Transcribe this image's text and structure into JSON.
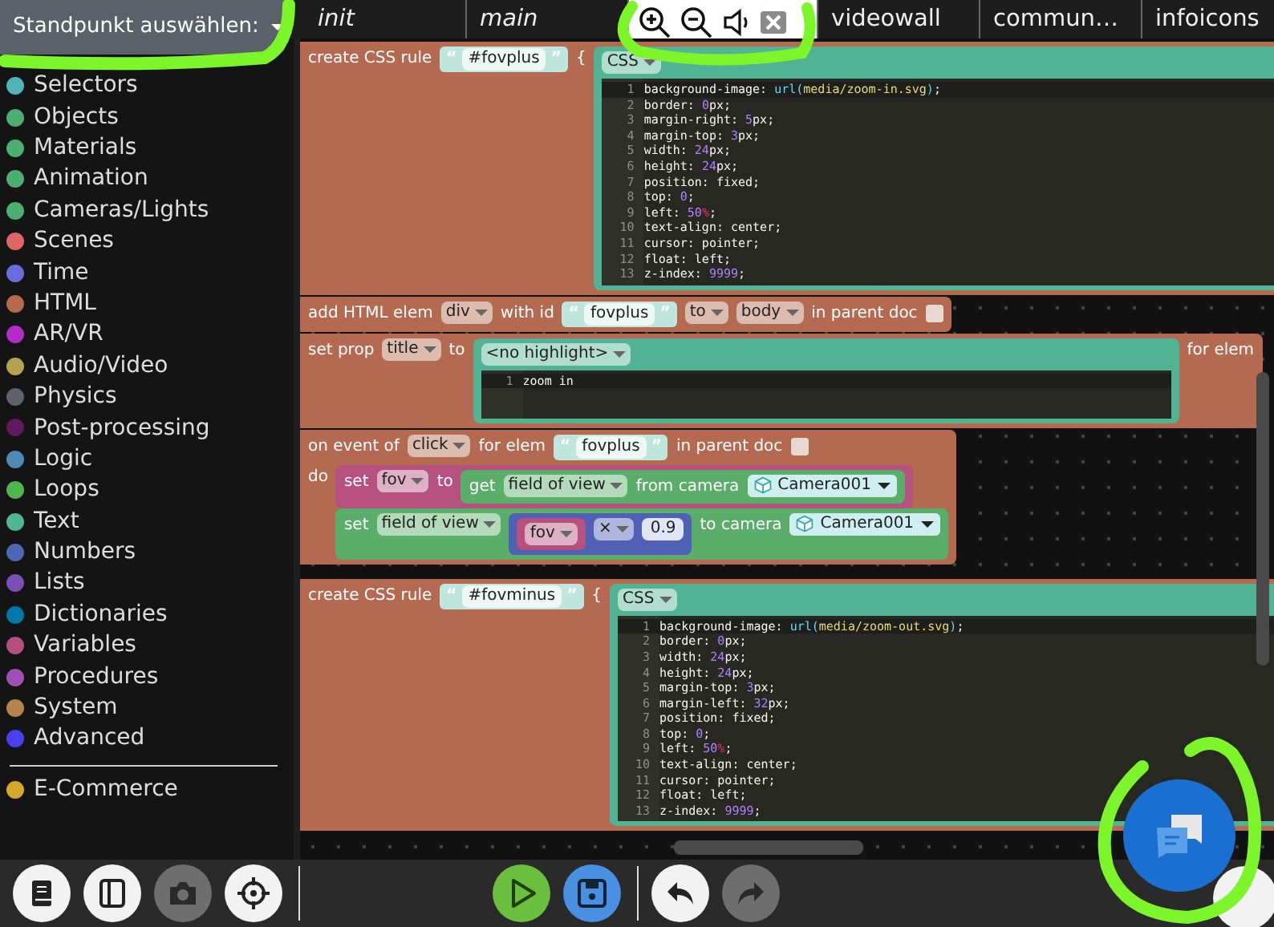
{
  "view_selector": {
    "label": "Standpunkt auswählen:"
  },
  "tabs": [
    {
      "label": "init",
      "italic": true,
      "selected": false
    },
    {
      "label": "main",
      "italic": true,
      "selected": false
    },
    {
      "selected": true,
      "italic": false
    },
    {
      "label": "videowall",
      "italic": false,
      "selected": false
    },
    {
      "label": "commun…",
      "italic": false,
      "selected": false
    },
    {
      "label": "infoicons",
      "italic": false,
      "selected": false
    }
  ],
  "sidebar": {
    "categories": [
      {
        "name": "Selectors",
        "color": "#4fb3b8"
      },
      {
        "name": "Objects",
        "color": "#4caf72"
      },
      {
        "name": "Materials",
        "color": "#4caf72"
      },
      {
        "name": "Animation",
        "color": "#4caf72"
      },
      {
        "name": "Cameras/Lights",
        "color": "#4caf72"
      },
      {
        "name": "Scenes",
        "color": "#e06666"
      },
      {
        "name": "Time",
        "color": "#6b6be0"
      },
      {
        "name": "HTML",
        "color": "#b5694f"
      },
      {
        "name": "AR/VR",
        "color": "#b52bc8"
      },
      {
        "name": "Audio/Video",
        "color": "#b5a24f"
      },
      {
        "name": "Physics",
        "color": "#5f6168"
      },
      {
        "name": "Post-processing",
        "color": "#5e1a5e"
      },
      {
        "name": "Logic",
        "color": "#4f87b5"
      },
      {
        "name": "Loops",
        "color": "#4fb54f"
      },
      {
        "name": "Text",
        "color": "#4fb594"
      },
      {
        "name": "Numbers",
        "color": "#4f66b5"
      },
      {
        "name": "Lists",
        "color": "#7a4fb5"
      },
      {
        "name": "Dictionaries",
        "color": "#0077aa"
      },
      {
        "name": "Variables",
        "color": "#b54f7f"
      },
      {
        "name": "Procedures",
        "color": "#a04fb5"
      },
      {
        "name": "System",
        "color": "#b5844f"
      },
      {
        "name": "Advanced",
        "color": "#4a3ff0"
      }
    ],
    "extra_categories": [
      {
        "name": "E-Commerce",
        "color": "#d4a82a"
      }
    ]
  },
  "workspace": {
    "blocks": [
      {
        "color": "#b36a50",
        "rows": [
          [
            {
              "kind": "label",
              "text": "create CSS rule"
            },
            {
              "kind": "string",
              "open": "“",
              "value": "#fovplus",
              "close": "”"
            },
            {
              "kind": "label",
              "text": "{"
            },
            {
              "kind": "block",
              "color": "#52b394",
              "rows": [
                [
                  {
                    "kind": "dropdown",
                    "value": "CSS"
                  }
                ],
                [
                  {
                    "kind": "code",
                    "lines": [
                      {
                        "number": "1",
                        "tokens": [
                          {
                            "kind": "plain",
                            "text": "background-image: "
                          },
                          {
                            "kind": "function",
                            "text": "url("
                          },
                          {
                            "kind": "string",
                            "text": "media/zoom-in.svg"
                          },
                          {
                            "kind": "function",
                            "text": ")"
                          },
                          {
                            "kind": "plain",
                            "text": ";"
                          }
                        ]
                      },
                      {
                        "number": "2",
                        "tokens": [
                          {
                            "kind": "plain",
                            "text": "border: "
                          },
                          {
                            "kind": "number",
                            "text": "0"
                          },
                          {
                            "kind": "plain",
                            "text": "px;"
                          }
                        ]
                      },
                      {
                        "number": "3",
                        "tokens": [
                          {
                            "kind": "plain",
                            "text": "margin-right: "
                          },
                          {
                            "kind": "number",
                            "text": "5"
                          },
                          {
                            "kind": "plain",
                            "text": "px;"
                          }
                        ]
                      },
                      {
                        "number": "4",
                        "tokens": [
                          {
                            "kind": "plain",
                            "text": "margin-top: "
                          },
                          {
                            "kind": "number",
                            "text": "3"
                          },
                          {
                            "kind": "plain",
                            "text": "px;"
                          }
                        ]
                      },
                      {
                        "number": "5",
                        "tokens": [
                          {
                            "kind": "plain",
                            "text": "width: "
                          },
                          {
                            "kind": "number",
                            "text": "24"
                          },
                          {
                            "kind": "plain",
                            "text": "px;"
                          }
                        ]
                      },
                      {
                        "number": "6",
                        "tokens": [
                          {
                            "kind": "plain",
                            "text": "height: "
                          },
                          {
                            "kind": "number",
                            "text": "24"
                          },
                          {
                            "kind": "plain",
                            "text": "px;"
                          }
                        ]
                      },
                      {
                        "number": "7",
                        "tokens": [
                          {
                            "kind": "plain",
                            "text": "position: fixed;"
                          }
                        ]
                      },
                      {
                        "number": "8",
                        "tokens": [
                          {
                            "kind": "plain",
                            "text": "top: "
                          },
                          {
                            "kind": "number",
                            "text": "0"
                          },
                          {
                            "kind": "plain",
                            "text": ";"
                          }
                        ]
                      },
                      {
                        "number": "9",
                        "tokens": [
                          {
                            "kind": "plain",
                            "text": "left: "
                          },
                          {
                            "kind": "number",
                            "text": "50"
                          },
                          {
                            "kind": "unit",
                            "text": "%"
                          },
                          {
                            "kind": "plain",
                            "text": ";"
                          }
                        ]
                      },
                      {
                        "number": "10",
                        "tokens": [
                          {
                            "kind": "plain",
                            "text": "text-align: center;"
                          }
                        ]
                      },
                      {
                        "number": "11",
                        "tokens": [
                          {
                            "kind": "plain",
                            "text": "cursor: pointer;"
                          }
                        ]
                      },
                      {
                        "number": "12",
                        "tokens": [
                          {
                            "kind": "plain",
                            "text": "float: left;"
                          }
                        ]
                      },
                      {
                        "number": "13",
                        "tokens": [
                          {
                            "kind": "plain",
                            "text": "z-index: "
                          },
                          {
                            "kind": "number",
                            "text": "9999"
                          },
                          {
                            "kind": "plain",
                            "text": ";"
                          }
                        ]
                      }
                    ]
                  }
                ]
              ]
            }
          ]
        ]
      },
      {
        "color": "#b36a50",
        "rows": [
          [
            {
              "kind": "label",
              "text": "add HTML elem"
            },
            {
              "kind": "dropdown",
              "value": "div"
            },
            {
              "kind": "label",
              "text": "with id"
            },
            {
              "kind": "string",
              "open": "“",
              "value": "fovplus",
              "close": "”"
            },
            {
              "kind": "dropdown",
              "value": "to"
            },
            {
              "kind": "dropdown",
              "value": "body"
            },
            {
              "kind": "label",
              "text": "in parent doc"
            },
            {
              "kind": "checkbox",
              "checked": false
            }
          ]
        ]
      },
      {
        "color": "#b36a50",
        "rows": [
          [
            {
              "kind": "label",
              "text": "set prop"
            },
            {
              "kind": "dropdown",
              "value": "title"
            },
            {
              "kind": "label",
              "text": "to"
            },
            {
              "kind": "block",
              "color": "#52b394",
              "rows": [
                [
                  {
                    "kind": "dropdown",
                    "value": "<no highlight>"
                  }
                ],
                [
                  {
                    "kind": "code",
                    "lines": [
                      {
                        "number": "1",
                        "tokens": [
                          {
                            "kind": "plain",
                            "text": "zoom in"
                          }
                        ]
                      }
                    ]
                  }
                ]
              ]
            },
            {
              "kind": "label",
              "text": "for elem"
            }
          ]
        ]
      },
      {
        "color": "#b36a50",
        "rows": [
          [
            {
              "kind": "label",
              "text": "on event of"
            },
            {
              "kind": "dropdown",
              "value": "click"
            },
            {
              "kind": "label",
              "text": "for elem"
            },
            {
              "kind": "string",
              "open": "“",
              "value": "fovplus",
              "close": "”"
            },
            {
              "kind": "label",
              "text": "in parent doc"
            },
            {
              "kind": "checkbox",
              "checked": false
            }
          ],
          [
            {
              "kind": "label",
              "text": "do"
            },
            {
              "kind": "stack",
              "blocks": [
                {
                  "color": "#b5507f",
                  "rows": [
                    [
                      {
                        "kind": "label",
                        "text": "set"
                      },
                      {
                        "kind": "dropdown",
                        "value": "fov"
                      },
                      {
                        "kind": "label",
                        "text": "to"
                      },
                      {
                        "kind": "block",
                        "color": "#5aae6a",
                        "rows": [
                          [
                            {
                              "kind": "label",
                              "text": "get"
                            },
                            {
                              "kind": "dropdown",
                              "value": "field of view"
                            },
                            {
                              "kind": "label",
                              "text": "from camera"
                            },
                            {
                              "kind": "object",
                              "value": "Camera001"
                            }
                          ]
                        ]
                      }
                    ]
                  ]
                },
                {
                  "color": "#5aae6a",
                  "rows": [
                    [
                      {
                        "kind": "label",
                        "text": "set"
                      },
                      {
                        "kind": "dropdown",
                        "value": "field of view"
                      },
                      {
                        "kind": "block",
                        "color": "#5060b5",
                        "rows": [
                          [
                            {
                              "kind": "block",
                              "color": "#b5507f",
                              "rows": [
                                [
                                  {
                                    "kind": "dropdown",
                                    "value": "fov"
                                  }
                                ]
                              ]
                            },
                            {
                              "kind": "dropdown",
                              "value": "×"
                            },
                            {
                              "kind": "number",
                              "value": "0.9"
                            }
                          ]
                        ]
                      },
                      {
                        "kind": "label",
                        "text": "to camera"
                      },
                      {
                        "kind": "object",
                        "value": "Camera001"
                      }
                    ]
                  ]
                }
              ]
            }
          ]
        ]
      },
      {
        "color": "#b36a50",
        "rows": [
          [
            {
              "kind": "label",
              "text": "create CSS rule"
            },
            {
              "kind": "string",
              "open": "“",
              "value": "#fovminus",
              "close": "”"
            },
            {
              "kind": "label",
              "text": "{"
            },
            {
              "kind": "block",
              "color": "#52b394",
              "rows": [
                [
                  {
                    "kind": "dropdown",
                    "value": "CSS"
                  }
                ],
                [
                  {
                    "kind": "code",
                    "lines": [
                      {
                        "number": "1",
                        "tokens": [
                          {
                            "kind": "plain",
                            "text": "background-image: "
                          },
                          {
                            "kind": "function",
                            "text": "url("
                          },
                          {
                            "kind": "string",
                            "text": "media/zoom-out.svg"
                          },
                          {
                            "kind": "function",
                            "text": ")"
                          },
                          {
                            "kind": "plain",
                            "text": ";"
                          }
                        ]
                      },
                      {
                        "number": "2",
                        "tokens": [
                          {
                            "kind": "plain",
                            "text": "border: "
                          },
                          {
                            "kind": "number",
                            "text": "0"
                          },
                          {
                            "kind": "plain",
                            "text": "px;"
                          }
                        ]
                      },
                      {
                        "number": "3",
                        "tokens": [
                          {
                            "kind": "plain",
                            "text": "width: "
                          },
                          {
                            "kind": "number",
                            "text": "24"
                          },
                          {
                            "kind": "plain",
                            "text": "px;"
                          }
                        ]
                      },
                      {
                        "number": "4",
                        "tokens": [
                          {
                            "kind": "plain",
                            "text": "height: "
                          },
                          {
                            "kind": "number",
                            "text": "24"
                          },
                          {
                            "kind": "plain",
                            "text": "px;"
                          }
                        ]
                      },
                      {
                        "number": "5",
                        "tokens": [
                          {
                            "kind": "plain",
                            "text": "margin-top: "
                          },
                          {
                            "kind": "number",
                            "text": "3"
                          },
                          {
                            "kind": "plain",
                            "text": "px;"
                          }
                        ]
                      },
                      {
                        "number": "6",
                        "tokens": [
                          {
                            "kind": "plain",
                            "text": "margin-left: "
                          },
                          {
                            "kind": "number",
                            "text": "32"
                          },
                          {
                            "kind": "plain",
                            "text": "px;"
                          }
                        ]
                      },
                      {
                        "number": "7",
                        "tokens": [
                          {
                            "kind": "plain",
                            "text": "position: fixed;"
                          }
                        ]
                      },
                      {
                        "number": "8",
                        "tokens": [
                          {
                            "kind": "plain",
                            "text": "top: "
                          },
                          {
                            "kind": "number",
                            "text": "0"
                          },
                          {
                            "kind": "plain",
                            "text": ";"
                          }
                        ]
                      },
                      {
                        "number": "9",
                        "tokens": [
                          {
                            "kind": "plain",
                            "text": "left: "
                          },
                          {
                            "kind": "number",
                            "text": "50"
                          },
                          {
                            "kind": "unit",
                            "text": "%"
                          },
                          {
                            "kind": "plain",
                            "text": ";"
                          }
                        ]
                      },
                      {
                        "number": "10",
                        "tokens": [
                          {
                            "kind": "plain",
                            "text": "text-align: center;"
                          }
                        ]
                      },
                      {
                        "number": "11",
                        "tokens": [
                          {
                            "kind": "plain",
                            "text": "cursor: pointer;"
                          }
                        ]
                      },
                      {
                        "number": "12",
                        "tokens": [
                          {
                            "kind": "plain",
                            "text": "float: left;"
                          }
                        ]
                      },
                      {
                        "number": "13",
                        "tokens": [
                          {
                            "kind": "plain",
                            "text": "z-index: "
                          },
                          {
                            "kind": "number",
                            "text": "9999"
                          },
                          {
                            "kind": "plain",
                            "text": ";"
                          }
                        ]
                      }
                    ]
                  }
                ]
              ]
            }
          ]
        ]
      }
    ]
  },
  "toolbar": {
    "groups": [
      [
        {
          "kind": "book",
          "color": "#f2f2f2"
        },
        {
          "kind": "panel",
          "color": "#f2f2f2"
        },
        {
          "kind": "camera",
          "color": "#6e6e6e"
        },
        {
          "kind": "crosshair",
          "color": "#f2f2f2"
        }
      ],
      [
        {
          "kind": "play",
          "color": "#6abf3f"
        },
        {
          "kind": "save",
          "color": "#4a90e2"
        }
      ],
      [
        {
          "kind": "undo",
          "color": "#f2f2f2"
        },
        {
          "kind": "redo",
          "color": "#6e6e6e"
        }
      ]
    ]
  }
}
